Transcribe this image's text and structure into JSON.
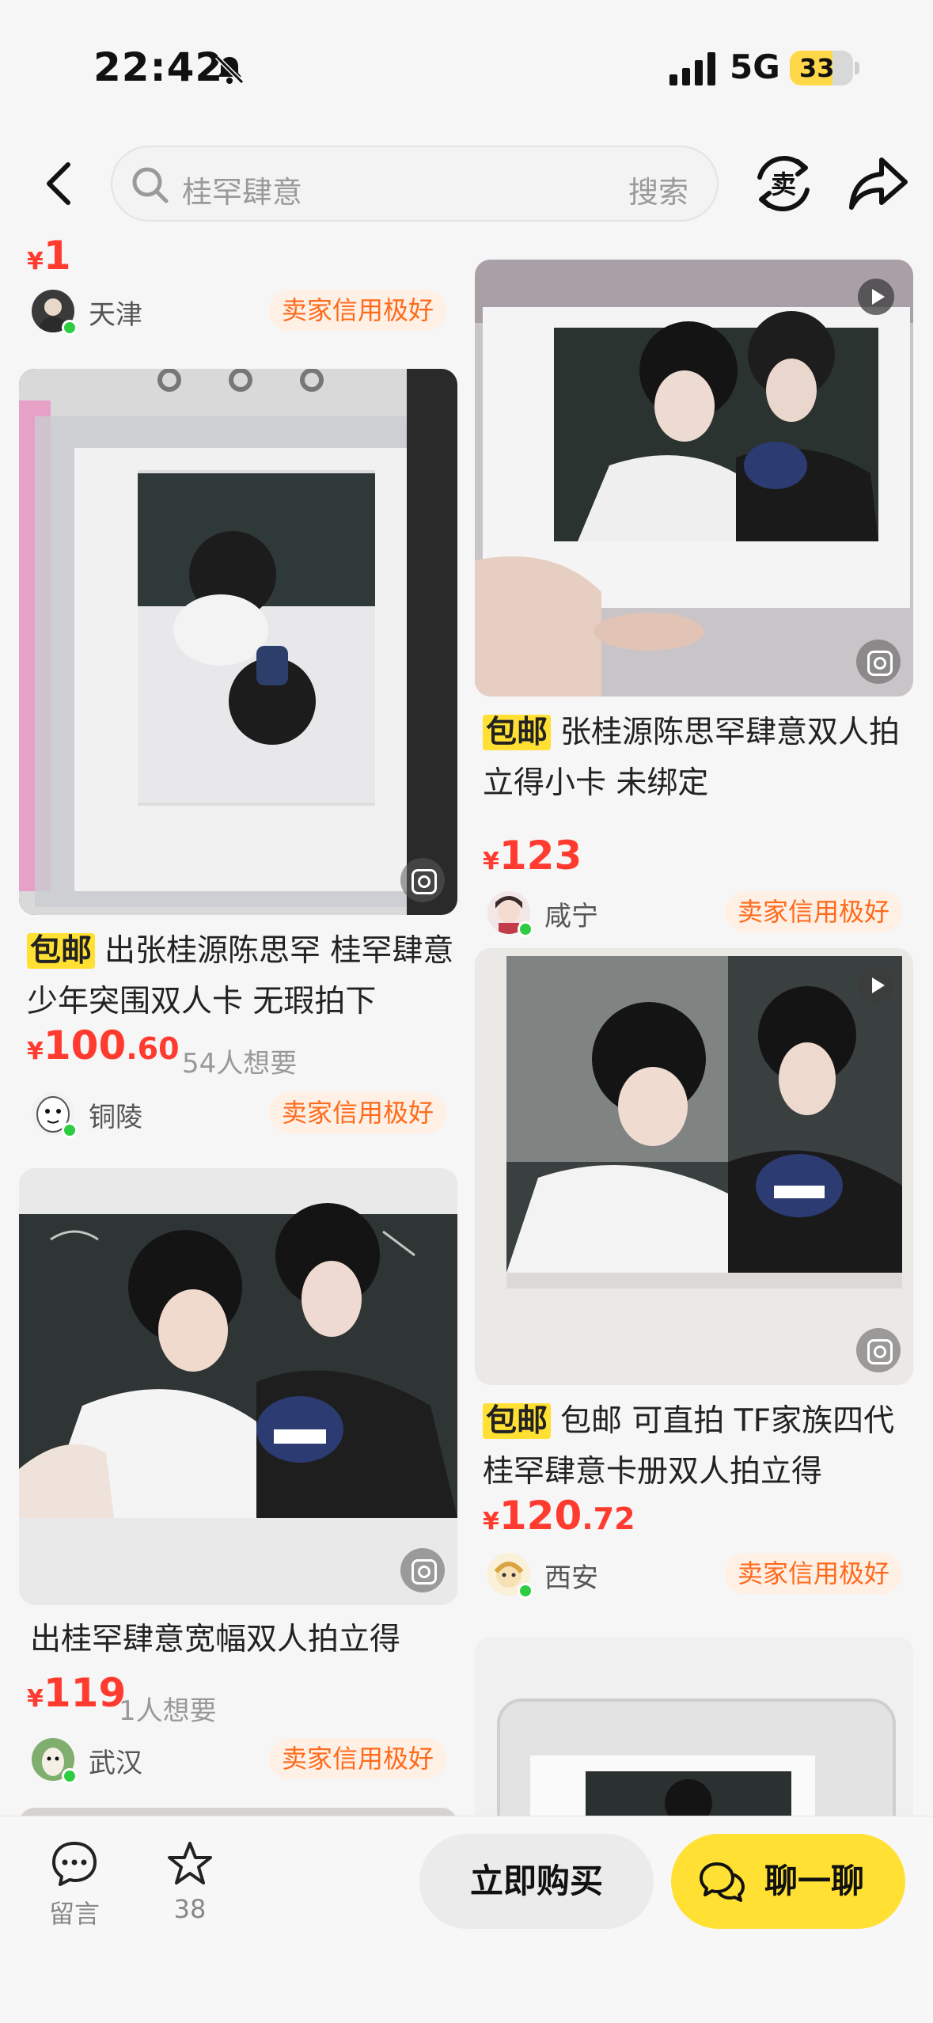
{
  "status_bar": {
    "time": "22:42",
    "network": "5G",
    "battery": "33"
  },
  "header": {
    "search_placeholder": "桂罕肆意",
    "search_button": "搜索"
  },
  "icons": {
    "back": "back-chevron-icon",
    "search": "search-icon",
    "sell": "sell-icon",
    "share": "share-icon",
    "comment": "comment-icon",
    "star": "star-icon",
    "chat": "chat-bubbles-icon",
    "bell_off": "bell-slash-icon",
    "signal": "signal-icon"
  },
  "colors": {
    "price": "#ff3b30",
    "accent": "#ffe033",
    "credit_text": "#ff6a1a",
    "credit_bg": "#fff0e6",
    "online": "#2ecc40"
  },
  "left_column": [
    {
      "price_yen": "¥",
      "price_int": "1",
      "price_dec": "",
      "seller_city": "天津",
      "credit": "卖家信用极好"
    },
    {
      "tag": "包邮",
      "title": "出张桂源陈思罕 桂罕肆意少年突围双人卡 无瑕拍下",
      "price_yen": "¥",
      "price_int": "100",
      "price_dec": ".60",
      "wants": "54人想要",
      "seller_city": "铜陵",
      "credit": "卖家信用极好"
    },
    {
      "title": "出桂罕肆意宽幅双人拍立得",
      "price_yen": "¥",
      "price_int": "119",
      "price_dec": "",
      "wants": "1人想要",
      "seller_city": "武汉",
      "credit": "卖家信用极好"
    }
  ],
  "right_column": [
    {
      "tag": "包邮",
      "title": "张桂源陈思罕肆意双人拍立得小卡 未绑定",
      "price_yen": "¥",
      "price_int": "123",
      "price_dec": "",
      "seller_city": "咸宁",
      "credit": "卖家信用极好"
    },
    {
      "tag": "包邮",
      "title": "包邮 可直拍 TF家族四代桂罕肆意卡册双人拍立得",
      "price_yen": "¥",
      "price_int": "120",
      "price_dec": ".72",
      "seller_city": "西安",
      "credit": "卖家信用极好"
    }
  ],
  "bottom_bar": {
    "comment_label": "留言",
    "favorite_count": "38",
    "buy_label": "立即购买",
    "chat_label": "聊一聊"
  }
}
